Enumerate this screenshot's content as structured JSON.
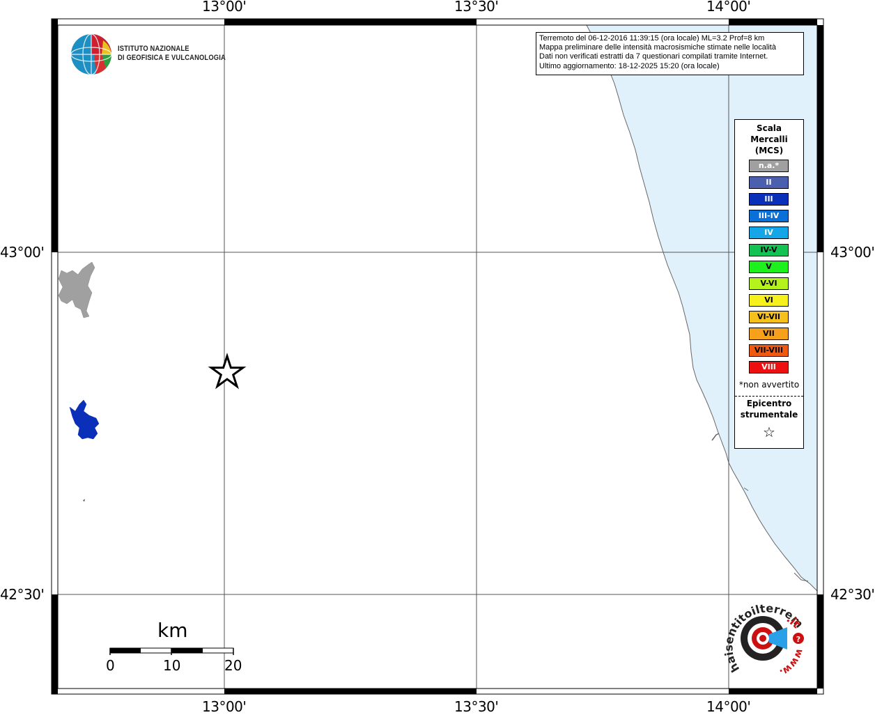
{
  "map": {
    "lon_labels": [
      "13°00'",
      "13°30'",
      "14°00'"
    ],
    "lat_labels": [
      "43°00'",
      "42°30'"
    ]
  },
  "info_box": {
    "lines": [
      "Terremoto del 06-12-2016 11:39:15 (ora locale) ML=3.2 Prof=8 km",
      "Mappa preliminare delle intensità macrosismiche stimate nelle località",
      "Dati non verificati estratti da 7 questionari compilati tramite Internet.",
      "Ultimo aggiornamento: 18-12-2025 15:20 (ora locale)"
    ]
  },
  "logo": {
    "line1": "ISTITUTO NAZIONALE",
    "line2": "DI GEOFISICA E VULCANOLOGIA"
  },
  "legend": {
    "title_lines": [
      "Scala",
      "Mercalli",
      "(MCS)"
    ],
    "items": [
      {
        "label": "n.a.*",
        "color": "#a0a0a0"
      },
      {
        "label": "II",
        "color": "#4a5fae"
      },
      {
        "label": "III",
        "color": "#0a2fb8"
      },
      {
        "label": "III-IV",
        "color": "#0a6fd6"
      },
      {
        "label": "IV",
        "color": "#14a6e6"
      },
      {
        "label": "IV-V",
        "color": "#12c354"
      },
      {
        "label": "V",
        "color": "#1ef01e"
      },
      {
        "label": "V-VI",
        "color": "#b4f41c"
      },
      {
        "label": "VI",
        "color": "#f6f01c"
      },
      {
        "label": "VI-VII",
        "color": "#f6c01c"
      },
      {
        "label": "VII",
        "color": "#f6a01c"
      },
      {
        "label": "VII-VIII",
        "color": "#f05a10"
      },
      {
        "label": "VIII",
        "color": "#ee1010"
      }
    ],
    "not_felt_note": "*non avvertito",
    "epicenter_lines": [
      "Epicentro",
      "strumentale"
    ],
    "epicenter_symbol": "☆"
  },
  "scale_bar": {
    "unit": "km",
    "ticks": [
      "0",
      "10",
      "20"
    ]
  },
  "brand": {
    "text_main": "haisentitoilterremoto",
    "text_suffix": ".it",
    "text_www": "www."
  },
  "colors": {
    "sea": "#e0f1fc",
    "coast": "#666666",
    "grid": "#555555",
    "lake_grey": "#a0a0a0",
    "lake_blue": "#0a2fb8"
  }
}
